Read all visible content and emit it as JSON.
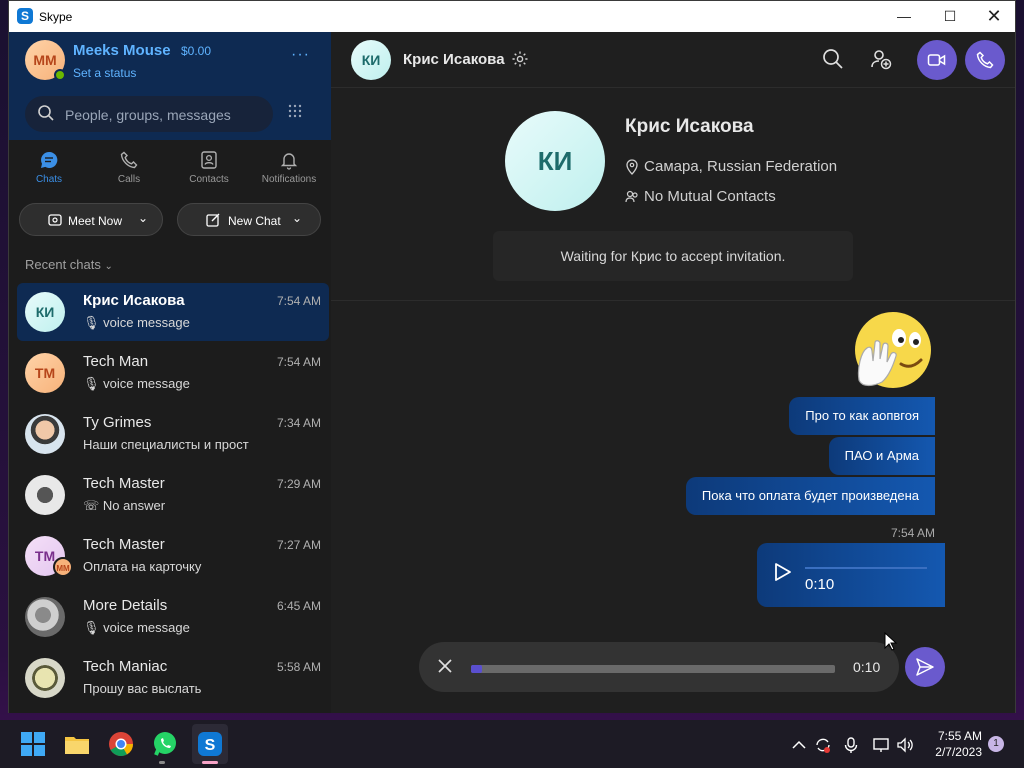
{
  "window": {
    "title": "Skype",
    "logo": "S"
  },
  "profile": {
    "initials": "MM",
    "name": "Meeks Mouse",
    "balance": "$0.00",
    "status": "Set a status",
    "more": "···"
  },
  "search": {
    "placeholder": "People, groups, messages"
  },
  "nav": [
    {
      "label": "Chats",
      "icon": "chat-bubble-icon",
      "active": true
    },
    {
      "label": "Calls",
      "icon": "phone-icon",
      "active": false
    },
    {
      "label": "Contacts",
      "icon": "contacts-icon",
      "active": false
    },
    {
      "label": "Notifications",
      "icon": "bell-icon",
      "active": false
    }
  ],
  "actions": {
    "meet_now": "Meet Now",
    "new_chat": "New Chat"
  },
  "recent_label": "Recent chats",
  "chats": [
    {
      "name": "Крис Исакова",
      "time": "7:54 AM",
      "preview": "voice message",
      "initials": "КИ",
      "preview_icon": "mic-icon"
    },
    {
      "name": "Tech Man",
      "time": "7:54 AM",
      "preview": "voice message",
      "initials": "TM",
      "preview_icon": "mic-icon"
    },
    {
      "name": "Ty Grimes",
      "time": "7:34 AM",
      "preview": "Наши специалисты и прост",
      "initials": "",
      "preview_icon": ""
    },
    {
      "name": "Tech Master",
      "time": "7:29 AM",
      "preview": "No answer",
      "initials": "",
      "preview_icon": "missed-call-icon"
    },
    {
      "name": "Tech Master",
      "time": "7:27 AM",
      "preview": "Оплата на карточку",
      "initials": "TM",
      "preview_icon": ""
    },
    {
      "name": "More Details",
      "time": "6:45 AM",
      "preview": "voice message",
      "initials": "",
      "preview_icon": "mic-icon"
    },
    {
      "name": "Tech Maniac",
      "time": "5:58 AM",
      "preview": "Прошу вас выслать",
      "initials": "",
      "preview_icon": ""
    }
  ],
  "conversation": {
    "header_initials": "КИ",
    "header_name": "Крис Исакова",
    "profile_name": "Крис Исакова",
    "location": "Самара, Russian Federation",
    "mutual": "No Mutual Contacts",
    "waiting": "Waiting for Крис to accept invitation.",
    "messages": [
      "Про то как аопвгоя",
      "ПАО и Арма",
      "Пока что оплата будет произведена"
    ],
    "voice_time_label": "7:54 AM",
    "voice_duration": "0:10",
    "recording_duration": "0:10",
    "recording_progress": 0.03
  },
  "taskbar": {
    "time": "7:55 AM",
    "date": "2/7/2023",
    "notifications": "1"
  },
  "colors": {
    "accent": "#6a5acd",
    "selected": "#0e2a52",
    "link": "#5fb3ff",
    "online": "#6bb700"
  }
}
